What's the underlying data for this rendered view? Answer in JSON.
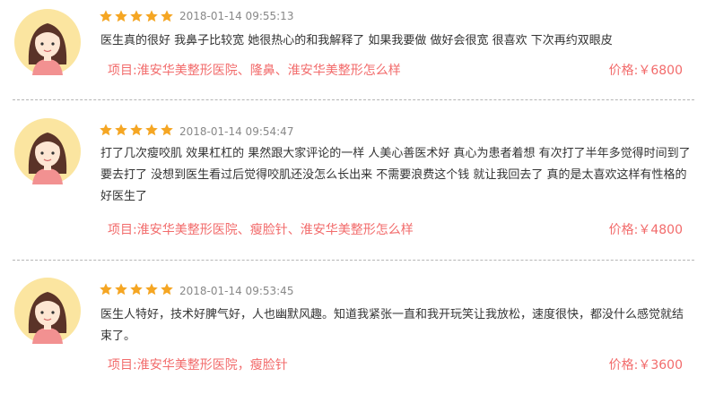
{
  "colors": {
    "accent": "#f26b6b",
    "star": "#f5a623",
    "avatar_bg": "#fbe5a0",
    "hair": "#5a3328",
    "shirt": "#f29191"
  },
  "reviews": [
    {
      "rating": 5,
      "date": "2018-01-14 09:55:13",
      "text": "医生真的很好 我鼻子比较宽 她很热心的和我解释了 如果我要做 做好会很宽 很喜欢 下次再约双眼皮",
      "project": "项目:淮安华美整形医院、隆鼻、淮安华美整形怎么样",
      "price": "价格:￥6800"
    },
    {
      "rating": 5,
      "date": "2018-01-14 09:54:47",
      "text": "打了几次瘦咬肌 效果杠杠的 果然跟大家评论的一样 人美心善医术好 真心为患者着想 有次打了半年多觉得时间到了 要去打了 没想到医生看过后觉得咬肌还没怎么长出来 不需要浪费这个钱 就让我回去了 真的是太喜欢这样有性格的好医生了",
      "project": "项目:淮安华美整形医院、瘦脸针、淮安华美整形怎么样",
      "price": "价格:￥4800"
    },
    {
      "rating": 5,
      "date": "2018-01-14 09:53:45",
      "text": "医生人特好，技术好脾气好，人也幽默风趣。知道我紧张一直和我开玩笑让我放松，速度很快，都没什么感觉就结束了。",
      "project": "项目:淮安华美整形医院，瘦脸针",
      "price": "价格:￥3600"
    }
  ]
}
